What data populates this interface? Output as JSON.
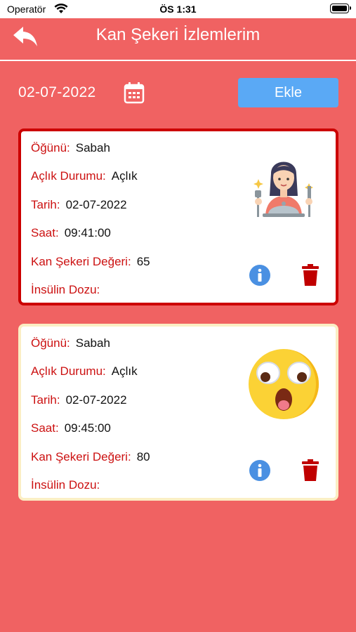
{
  "status_bar": {
    "carrier": "Operatör",
    "time": "ÖS 1:31"
  },
  "header": {
    "title": "Kan Şekeri İzlemlerim"
  },
  "date_row": {
    "date": "02-07-2022",
    "add_label": "Ekle"
  },
  "labels": {
    "meal": "Öğünü:",
    "fasting": "Açlık Durumu:",
    "date": "Tarih:",
    "time": "Saat:",
    "value": "Kan Şekeri Değeri:",
    "insulin": "İnsülin Dozu:"
  },
  "records": [
    {
      "meal": "Sabah",
      "fasting": "Açlık",
      "date": "02-07-2022",
      "time": "09:41:00",
      "value": "65",
      "insulin": "",
      "icon": "woman-eating-icon",
      "border_color": "#cc0000"
    },
    {
      "meal": "Sabah",
      "fasting": "Açlık",
      "date": "02-07-2022",
      "time": "09:45:00",
      "value": "80",
      "insulin": "",
      "icon": "shocked-emoji-icon",
      "border_color": "#fbeec4"
    }
  ],
  "colors": {
    "background": "#f06262",
    "label": "#cc1111",
    "button": "#5aa9f5",
    "info": "#4a90e2",
    "trash": "#c00000"
  }
}
